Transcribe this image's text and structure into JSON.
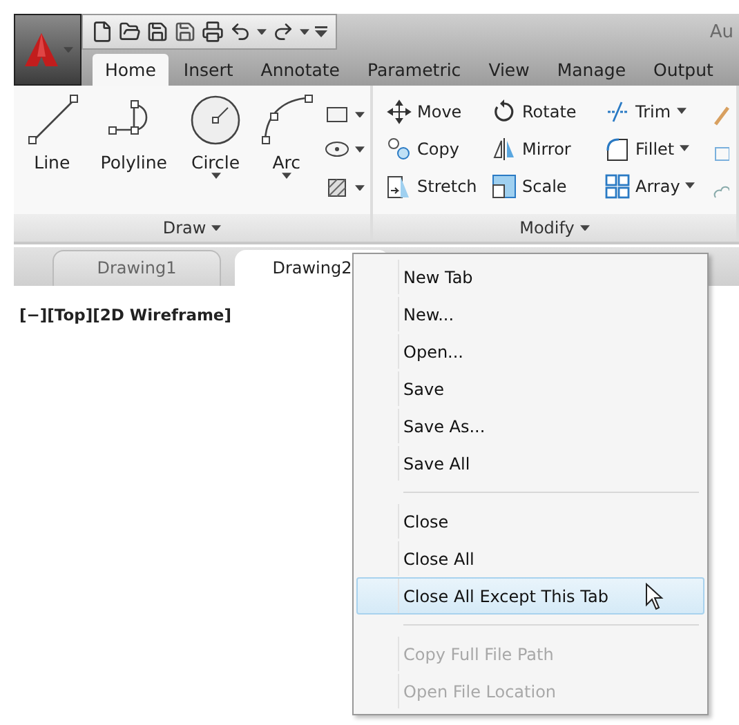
{
  "title": "Au",
  "ribbon_tabs": [
    {
      "label": "Home",
      "selected": true
    },
    {
      "label": "Insert",
      "selected": false
    },
    {
      "label": "Annotate",
      "selected": false
    },
    {
      "label": "Parametric",
      "selected": false
    },
    {
      "label": "View",
      "selected": false
    },
    {
      "label": "Manage",
      "selected": false
    },
    {
      "label": "Output",
      "selected": false
    }
  ],
  "draw_panel": {
    "label": "Draw",
    "tools": [
      {
        "kind": "line",
        "label": "Line",
        "dropdown": false
      },
      {
        "kind": "polyline",
        "label": "Polyline",
        "dropdown": false
      },
      {
        "kind": "circle",
        "label": "Circle",
        "dropdown": true
      },
      {
        "kind": "arc",
        "label": "Arc",
        "dropdown": true
      }
    ]
  },
  "modify_panel": {
    "label": "Modify",
    "tools": [
      {
        "kind": "move",
        "label": "Move",
        "dropdown": false
      },
      {
        "kind": "rotate",
        "label": "Rotate",
        "dropdown": false
      },
      {
        "kind": "trim",
        "label": "Trim",
        "dropdown": true
      },
      {
        "kind": "copy",
        "label": "Copy",
        "dropdown": false
      },
      {
        "kind": "mirror",
        "label": "Mirror",
        "dropdown": false
      },
      {
        "kind": "fillet",
        "label": "Fillet",
        "dropdown": true
      },
      {
        "kind": "stretch",
        "label": "Stretch",
        "dropdown": false
      },
      {
        "kind": "scale",
        "label": "Scale",
        "dropdown": false
      },
      {
        "kind": "array",
        "label": "Array",
        "dropdown": true
      }
    ]
  },
  "document_tabs": [
    {
      "label": "Drawing1",
      "selected": false
    },
    {
      "label": "Drawing2",
      "selected": true
    }
  ],
  "viewport_label": "[−][Top][2D Wireframe]",
  "context_menu": [
    [
      {
        "label": "New Tab",
        "disabled": false,
        "selected": false
      },
      {
        "label": "New...",
        "disabled": false,
        "selected": false
      },
      {
        "label": "Open...",
        "disabled": false,
        "selected": false
      },
      {
        "label": "Save",
        "disabled": false,
        "selected": false
      },
      {
        "label": "Save As...",
        "disabled": false,
        "selected": false
      },
      {
        "label": "Save All",
        "disabled": false,
        "selected": false
      }
    ],
    [
      {
        "label": "Close",
        "disabled": false,
        "selected": false
      },
      {
        "label": "Close All",
        "disabled": false,
        "selected": false
      },
      {
        "label": "Close All Except This Tab",
        "disabled": false,
        "selected": true
      }
    ],
    [
      {
        "label": "Copy Full File Path",
        "disabled": true,
        "selected": false
      },
      {
        "label": "Open File Location",
        "disabled": true,
        "selected": false
      }
    ]
  ]
}
